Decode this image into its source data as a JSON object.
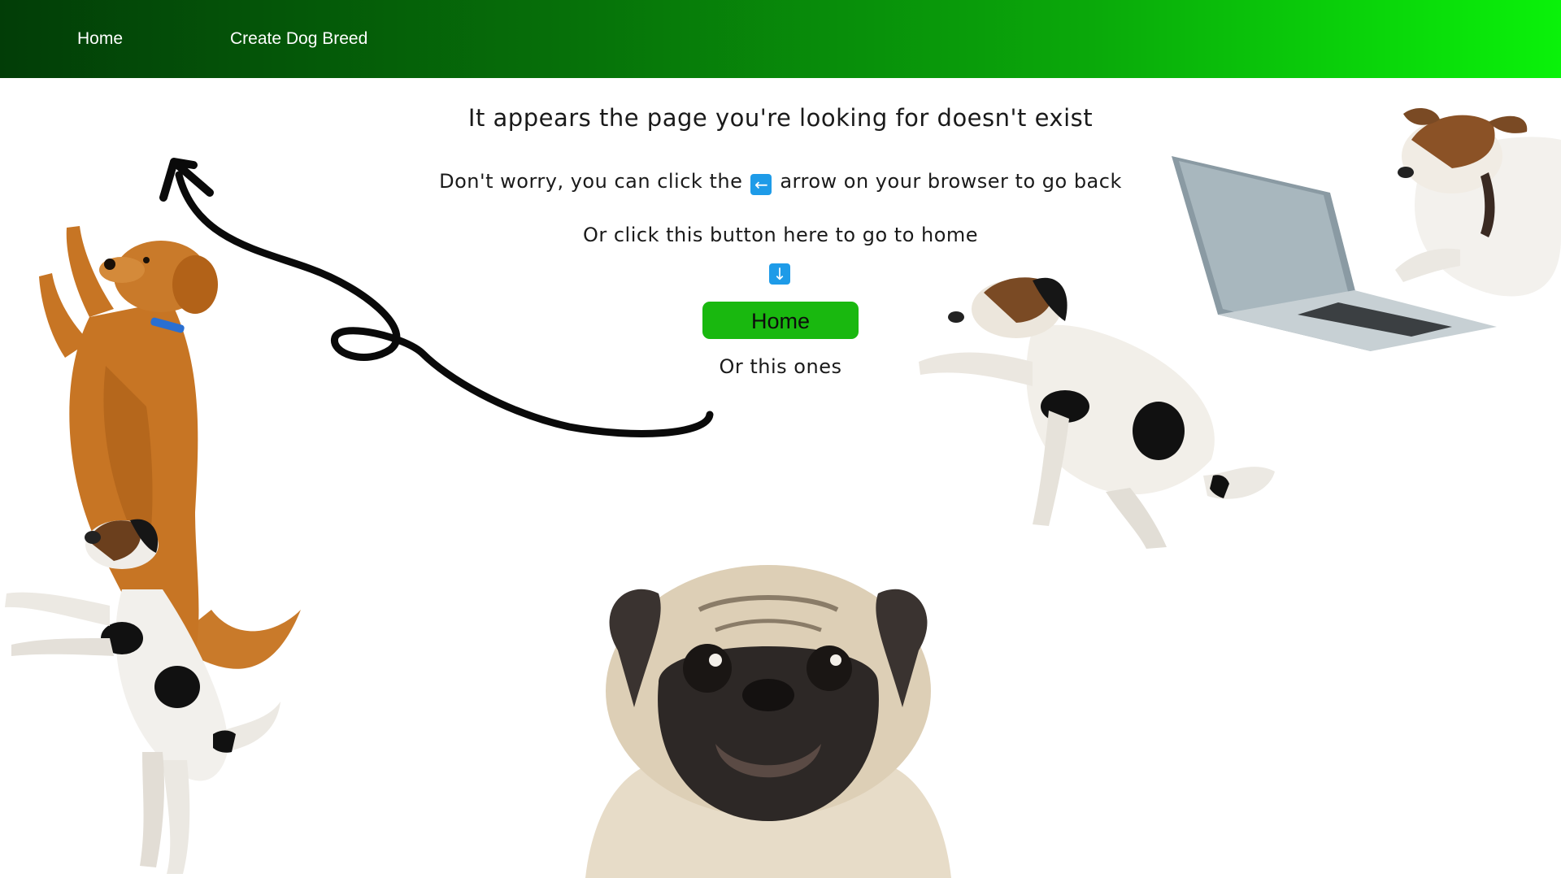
{
  "nav": {
    "home_label": "Home",
    "create_label": "Create Dog Breed"
  },
  "message": {
    "title": "It appears the page you're looking for doesn't exist",
    "back_prefix": "Don't worry, you can click the",
    "back_suffix": "arrow on your browser to go back",
    "home_hint": "Or click this button here to go to home",
    "others": "Or this ones"
  },
  "icons": {
    "back_key": "←",
    "down_key": "↓"
  },
  "home_button": {
    "label": "Home"
  },
  "colors": {
    "nav_gradient_start": "#023d07",
    "nav_gradient_end": "#0af20a",
    "button_green": "#19b80f",
    "key_blue": "#1e9be8"
  }
}
